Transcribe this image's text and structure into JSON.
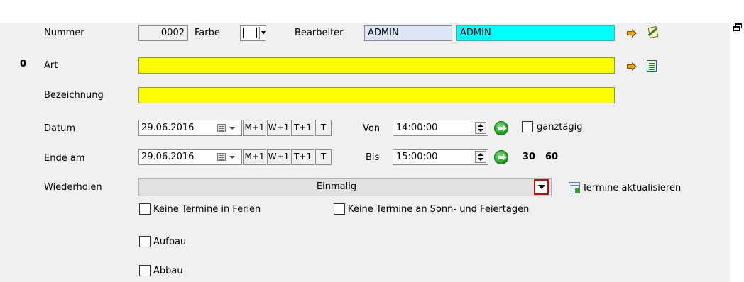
{
  "left_marker": "0",
  "labels": {
    "nummer": "Nummer",
    "farbe": "Farbe",
    "bearbeiter": "Bearbeiter",
    "art": "Art",
    "bezeichnung": "Bezeichnung",
    "datum": "Datum",
    "ende_am": "Ende am",
    "wiederholen": "Wiederholen",
    "von": "Von",
    "bis": "Bis"
  },
  "fields": {
    "nummer": "0002",
    "bearbeiter_1": "ADMIN",
    "bearbeiter_2": "ADMIN",
    "art": "",
    "bezeichnung": "",
    "datum": "29.06.2016",
    "ende_am": "29.06.2016",
    "von": "14:00:00",
    "bis": "15:00:00"
  },
  "quick_buttons": [
    "M+1",
    "W+1",
    "T+1",
    "T"
  ],
  "ganztaegig_label": "ganztägig",
  "duration_links": [
    "30",
    "60"
  ],
  "wiederholen": {
    "selected": "Einmalig",
    "refresh_label": "Termine aktualisieren"
  },
  "checkboxes": {
    "keine_ferien": "Keine Termine in Ferien",
    "keine_sonn_feiertage": "Keine Termine an Sonn- und Feiertagen",
    "aufbau": "Aufbau",
    "abbau": "Abbau"
  },
  "colors": {
    "required_field": "#ffff00",
    "bearbeiter_name": "#00ffff",
    "dropdown_highlight": "#d40000",
    "go_button": "#1a9a1a"
  },
  "icons": {
    "arrow": "orange-arrow-icon",
    "task": "task-edit-icon",
    "list": "list-icon",
    "go": "green-go-icon",
    "calendar": "calendar-icon",
    "restore": "window-restore-icon"
  }
}
